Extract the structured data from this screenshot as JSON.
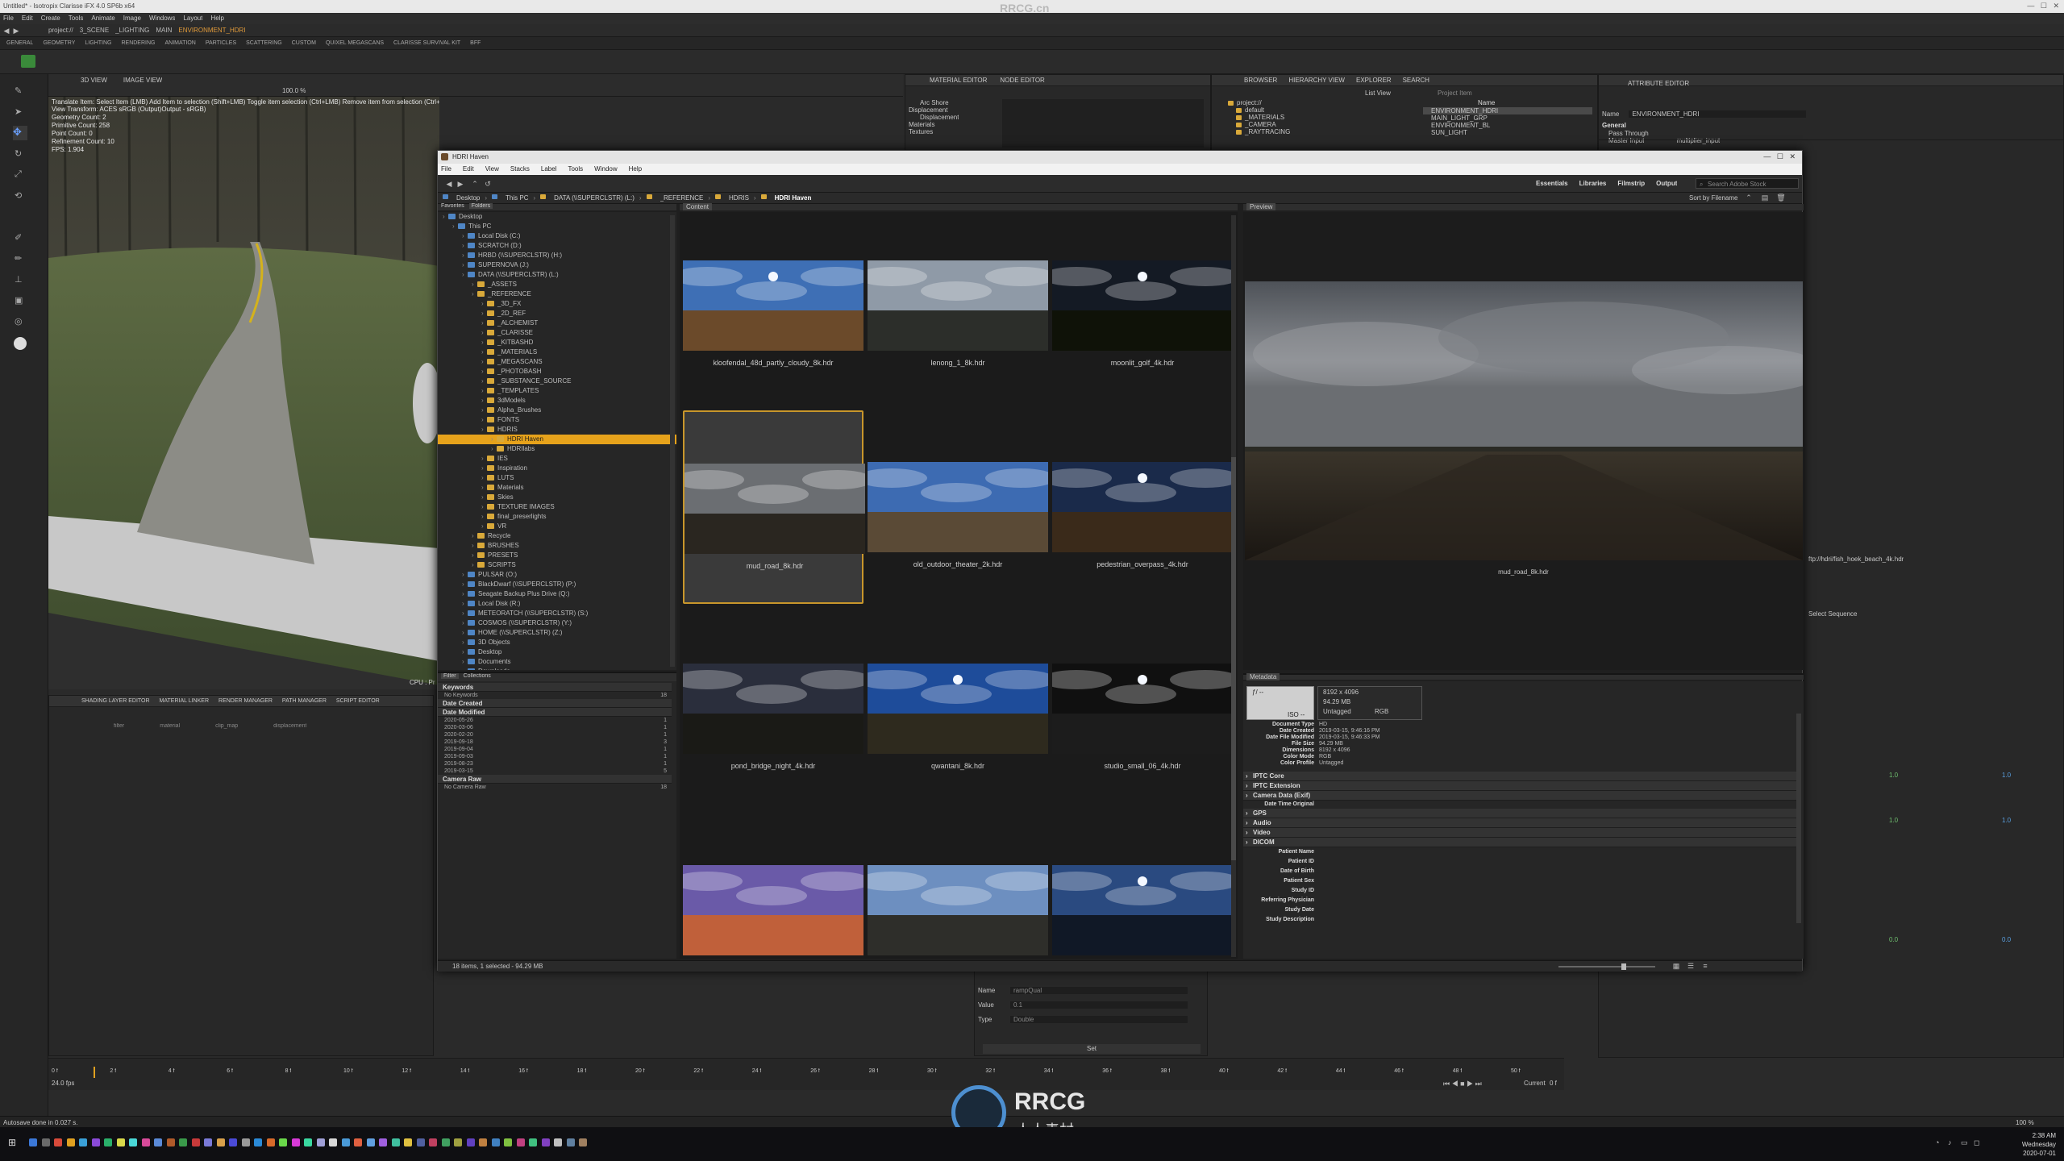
{
  "watermark_top": "RRCG.cn",
  "clarisse": {
    "title": "Untitled* - Isotropix Clarisse iFX 4.0 SP6b x64",
    "menu": [
      "File",
      "Edit",
      "Create",
      "Tools",
      "Animate",
      "Image",
      "Windows",
      "Layout",
      "Help"
    ],
    "path": [
      "project://",
      "3_SCENE",
      "_LIGHTING",
      "MAIN",
      "ENVIRONMENT_HDRI"
    ],
    "shelf_tabs": [
      "GENERAL",
      "GEOMETRY",
      "LIGHTING",
      "RENDERING",
      "ANIMATION",
      "PARTICLES",
      "SCATTERING",
      "CUSTOM",
      "QUIXEL MEGASCANS",
      "CLARISSE SURVIVAL KIT",
      "BFF"
    ],
    "viewport_tabs": [
      "3D VIEW",
      "IMAGE VIEW"
    ],
    "viewport_hint": "Translate Item: Select Item (LMB)  Add Item to selection (Shift+LMB)  Toggle item selection (Ctrl+LMB)  Remove item from selection (Ctrl+Shift+LMB)",
    "viewport_stats": [
      "View Transform: ACES sRGB (Output)Output - sRGB)",
      "Geometry Count: 2",
      "Primitive Count: 258",
      "Point Count: 0",
      "Refinement Count: 10",
      "FPS: 1.904"
    ],
    "viewport_zoom": "100.0 %",
    "cpu_label": "CPU : Pr",
    "material_tabs": [
      "MATERIAL EDITOR",
      "NODE EDITOR"
    ],
    "material_tree": [
      "Arc Shore",
      "Displacement",
      "Displacement",
      "Materials",
      "Textures"
    ],
    "browser_tabs": [
      "BROWSER",
      "HIERARCHY VIEW",
      "EXPLORER",
      "SEARCH"
    ],
    "browser_view": "List View",
    "browser_search_placeholder": "Project Item",
    "browser_tree": [
      "project://",
      "default",
      "_MATERIALS",
      "_CAMERA",
      "_RAYTRACING"
    ],
    "browser_list_header": "Name",
    "browser_list": [
      "ENVIRONMENT_HDRI",
      "MAIN_LIGHT_GRP",
      "ENVIRONMENT_BL",
      "SUN_LIGHT"
    ],
    "attribute_tab": "ATTRIBUTE EDITOR",
    "attr_name_label": "Name",
    "attr_name_value": "ENVIRONMENT_HDRI",
    "attr_group": "General",
    "attr_rows": [
      {
        "k": "Pass Through",
        "v": ""
      },
      {
        "k": "Master Input",
        "v": "multiplier_input"
      }
    ],
    "right_side_texts": [
      "ftp://hdri/fish_hoek_beach_4k.hdr",
      "Select Sequence"
    ],
    "right_side_values": [
      "1.0",
      "1.0",
      "1.0",
      "1.0",
      "0.0",
      "0.0"
    ],
    "bottom_tabs": [
      "SHADING LAYER EDITOR",
      "MATERIAL LINKER",
      "RENDER MANAGER",
      "PATH MANAGER",
      "SCRIPT EDITOR"
    ],
    "shading_cols": [
      "filter",
      "material",
      "clip_map",
      "displacement"
    ],
    "var_fields": [
      {
        "k": "Name",
        "v": "rampQual"
      },
      {
        "k": "Value",
        "v": "0.1"
      },
      {
        "k": "Type",
        "v": "Double"
      }
    ],
    "var_set_button": "Set",
    "timeline_labels": [
      "0 f",
      "2 f",
      "4 f",
      "6 f",
      "8 f",
      "10 f",
      "12 f",
      "14 f",
      "16 f",
      "18 f",
      "20 f",
      "22 f",
      "24 f",
      "26 f",
      "28 f",
      "30 f",
      "32 f",
      "34 f",
      "36 f",
      "38 f",
      "40 f",
      "42 f",
      "44 f",
      "46 f",
      "48 f",
      "50 f"
    ],
    "fps": "24.0 fps",
    "current_label": "Current",
    "current_value": "0 f",
    "status": "Autosave done in 0.027 s.",
    "zoom_readout": "100 %"
  },
  "bridge": {
    "title": "HDRI Haven",
    "menu": [
      "File",
      "Edit",
      "View",
      "Stacks",
      "Label",
      "Tools",
      "Window",
      "Help"
    ],
    "workspaces": [
      "Essentials",
      "Libraries",
      "Filmstrip",
      "Output"
    ],
    "search_placeholder": "Search Adobe Stock",
    "sort_label": "Sort by Filename",
    "breadcrumb": [
      "Desktop",
      "This PC",
      "DATA (\\\\SUPERCLSTR) (L:)",
      "_REFERENCE",
      "HDRIS",
      "HDRI Haven"
    ],
    "left_tabs": [
      "Favorites",
      "Folders"
    ],
    "content_tab": "Content",
    "preview_tab": "Preview",
    "metadata_tab": "Metadata",
    "filter_tabs": [
      "Filter",
      "Collections"
    ],
    "folders": [
      {
        "label": "Desktop",
        "depth": 0,
        "blue": true
      },
      {
        "label": "This PC",
        "depth": 1,
        "blue": true
      },
      {
        "label": "Local Disk (C:)",
        "depth": 2,
        "blue": true
      },
      {
        "label": "SCRATCH (D:)",
        "depth": 2,
        "blue": true
      },
      {
        "label": "HRBD (\\\\SUPERCLSTR) (H:)",
        "depth": 2,
        "blue": true
      },
      {
        "label": "SUPERNOVA (J:)",
        "depth": 2,
        "blue": true
      },
      {
        "label": "DATA (\\\\SUPERCLSTR) (L:)",
        "depth": 2,
        "blue": true
      },
      {
        "label": "_ASSETS",
        "depth": 3
      },
      {
        "label": "_REFERENCE",
        "depth": 3
      },
      {
        "label": "_3D_FX",
        "depth": 4
      },
      {
        "label": "_2D_REF",
        "depth": 4
      },
      {
        "label": "_ALCHEMIST",
        "depth": 4
      },
      {
        "label": "_CLARISSE",
        "depth": 4
      },
      {
        "label": "_KITBASHD",
        "depth": 4
      },
      {
        "label": "_MATERIALS",
        "depth": 4
      },
      {
        "label": "_MEGASCANS",
        "depth": 4
      },
      {
        "label": "_PHOTOBASH",
        "depth": 4
      },
      {
        "label": "_SUBSTANCE_SOURCE",
        "depth": 4
      },
      {
        "label": "_TEMPLATES",
        "depth": 4
      },
      {
        "label": "3dModels",
        "depth": 4
      },
      {
        "label": "Alpha_Brushes",
        "depth": 4
      },
      {
        "label": "FONTS",
        "depth": 4
      },
      {
        "label": "HDRIS",
        "depth": 4
      },
      {
        "label": "HDRI Haven",
        "depth": 5,
        "sel": true
      },
      {
        "label": "HDRIlabs",
        "depth": 5
      },
      {
        "label": "IES",
        "depth": 4
      },
      {
        "label": "Inspiration",
        "depth": 4
      },
      {
        "label": "LUTS",
        "depth": 4
      },
      {
        "label": "Materials",
        "depth": 4
      },
      {
        "label": "Skies",
        "depth": 4
      },
      {
        "label": "TEXTURE IMAGES",
        "depth": 4
      },
      {
        "label": "final_preserlights",
        "depth": 4
      },
      {
        "label": "VR",
        "depth": 4
      },
      {
        "label": "Recycle",
        "depth": 3
      },
      {
        "label": "BRUSHES",
        "depth": 3
      },
      {
        "label": "PRESETS",
        "depth": 3
      },
      {
        "label": "SCRIPTS",
        "depth": 3
      },
      {
        "label": "PULSAR (O:)",
        "depth": 2,
        "blue": true
      },
      {
        "label": "BlackDwarf (\\\\SUPERCLSTR) (P:)",
        "depth": 2,
        "blue": true
      },
      {
        "label": "Seagate Backup Plus Drive (Q:)",
        "depth": 2,
        "blue": true
      },
      {
        "label": "Local Disk (R:)",
        "depth": 2,
        "blue": true
      },
      {
        "label": "METEORATCH (\\\\SUPERCLSTR) (S:)",
        "depth": 2,
        "blue": true
      },
      {
        "label": "COSMOS (\\\\SUPERCLSTR) (Y:)",
        "depth": 2,
        "blue": true
      },
      {
        "label": "HOME (\\\\SUPERCLSTR) (Z:)",
        "depth": 2,
        "blue": true
      },
      {
        "label": "3D Objects",
        "depth": 2,
        "blue": true
      },
      {
        "label": "Desktop",
        "depth": 2,
        "blue": true
      },
      {
        "label": "Documents",
        "depth": 2,
        "blue": true
      },
      {
        "label": "Downloads",
        "depth": 2,
        "blue": true
      }
    ],
    "filter_sections": [
      {
        "title": "Keywords",
        "rows": [
          {
            "k": "No Keywords",
            "v": "18"
          }
        ]
      },
      {
        "title": "Date Created",
        "rows": []
      },
      {
        "title": "Date Modified",
        "rows": [
          {
            "k": "2020-05-26",
            "v": "1"
          },
          {
            "k": "2020-03-06",
            "v": "1"
          },
          {
            "k": "2020-02-20",
            "v": "1"
          },
          {
            "k": "2019-09-18",
            "v": "3"
          },
          {
            "k": "2019-09-04",
            "v": "1"
          },
          {
            "k": "2019-09-03",
            "v": "1"
          },
          {
            "k": "2019-08-23",
            "v": "1"
          },
          {
            "k": "2019-03-15",
            "v": "5"
          }
        ]
      },
      {
        "title": "Camera Raw",
        "rows": [
          {
            "k": "No Camera Raw",
            "v": "18"
          }
        ]
      }
    ],
    "thumbnails": [
      {
        "name": "kloofendal_48d_partly_cloudy_8k.hdr",
        "sky": "#3e6fb5",
        "ground": "#6b4a2a",
        "sun": true
      },
      {
        "name": "lenong_1_8k.hdr",
        "sky": "#8f9aa7",
        "ground": "#2c2e2a",
        "sun": false
      },
      {
        "name": "moonlit_golf_4k.hdr",
        "sky": "#141a24",
        "ground": "#0f1208",
        "sun": true
      },
      {
        "name": "mud_road_8k.hdr",
        "sky": "#6b6e72",
        "ground": "#2a2620",
        "sun": false,
        "selected": true
      },
      {
        "name": "old_outdoor_theater_2k.hdr",
        "sky": "#3d6bb2",
        "ground": "#5a4a36",
        "sun": false
      },
      {
        "name": "pedestrian_overpass_4k.hdr",
        "sky": "#1a2a4a",
        "ground": "#3a2a1a",
        "sun": true
      },
      {
        "name": "pond_bridge_night_4k.hdr",
        "sky": "#2a2e3c",
        "ground": "#1a1a16",
        "sun": false
      },
      {
        "name": "qwantani_8k.hdr",
        "sky": "#1e4c9a",
        "ground": "#2e2a1e",
        "sun": true
      },
      {
        "name": "studio_small_06_4k.hdr",
        "sky": "#101010",
        "ground": "#1c1c1c",
        "sun": true
      },
      {
        "name": "",
        "sky": "#6a5aa8",
        "ground": "#c0603a",
        "sun": false
      },
      {
        "name": "",
        "sky": "#6d8fc0",
        "ground": "#2e2e2a",
        "sun": false
      },
      {
        "name": "",
        "sky": "#2a4a80",
        "ground": "#101826",
        "sun": true
      }
    ],
    "preview_caption": "mud_road_8k.hdr",
    "metadata_summary": [
      "8192 x 4096",
      "94.29 MB",
      "Untagged",
      "RGB"
    ],
    "metadata_file": [
      {
        "k": "Document Type",
        "v": "HD"
      },
      {
        "k": "Date Created",
        "v": "2019-03-15, 9:46:16 PM"
      },
      {
        "k": "Date File Modified",
        "v": "2019-03-15, 9:46:33 PM"
      },
      {
        "k": "File Size",
        "v": "94.29 MB"
      },
      {
        "k": "Dimensions",
        "v": "8192 x 4096"
      },
      {
        "k": "Color Mode",
        "v": "RGB"
      },
      {
        "k": "Color Profile",
        "v": "Untagged"
      }
    ],
    "metadata_sections": [
      "IPTC Core",
      "IPTC Extension",
      "Camera Data (Exif)",
      "GPS",
      "Audio",
      "Video",
      "DICOM"
    ],
    "metadata_exif": [
      {
        "k": "Date Time Original",
        "v": ""
      }
    ],
    "metadata_dicom": [
      "Patient Name",
      "Patient ID",
      "Date of Birth",
      "Patient Sex",
      "Study ID",
      "Referring Physician",
      "Study Date",
      "Study Description"
    ],
    "status": "18 items, 1 selected - 94.29 MB"
  },
  "taskbar": {
    "time": "2:38 AM",
    "day": "Wednesday",
    "date": "2020-07-01"
  },
  "watermark_bottom": {
    "logo": "RRCG",
    "sub": "人人素材"
  }
}
